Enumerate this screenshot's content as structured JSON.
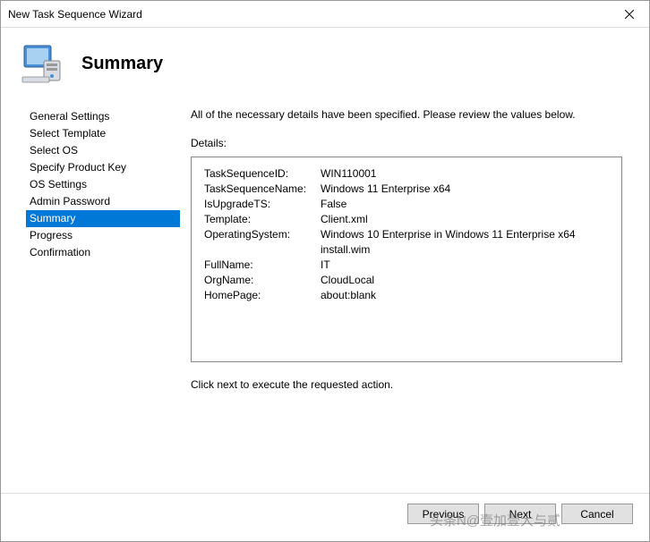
{
  "window": {
    "title": "New Task Sequence Wizard"
  },
  "header": {
    "title": "Summary"
  },
  "sidebar": {
    "items": [
      {
        "label": "General Settings"
      },
      {
        "label": "Select Template"
      },
      {
        "label": "Select OS"
      },
      {
        "label": "Specify Product Key"
      },
      {
        "label": "OS Settings"
      },
      {
        "label": "Admin Password"
      },
      {
        "label": "Summary"
      },
      {
        "label": "Progress"
      },
      {
        "label": "Confirmation"
      }
    ],
    "selected_index": 6
  },
  "main": {
    "instruction": "All of the necessary details have been specified.  Please review the values below.",
    "details_label": "Details:",
    "rows": [
      {
        "key": "TaskSequenceID:",
        "val": "WIN110001"
      },
      {
        "key": "TaskSequenceName:",
        "val": "Windows 11 Enterprise x64"
      },
      {
        "key": "IsUpgradeTS:",
        "val": "False"
      },
      {
        "key": "Template:",
        "val": "Client.xml"
      },
      {
        "key": "OperatingSystem:",
        "val": "Windows 10 Enterprise in Windows 11 Enterprise x64 install.wim"
      },
      {
        "key": "FullName:",
        "val": "IT"
      },
      {
        "key": "OrgName:",
        "val": "CloudLocal"
      },
      {
        "key": "HomePage:",
        "val": "about:blank"
      }
    ],
    "hint": "Click next to execute the requested action."
  },
  "footer": {
    "previous": "Previous",
    "next": "Next",
    "cancel": "Cancel"
  },
  "watermark": "头条N@壹加壹大与贰"
}
